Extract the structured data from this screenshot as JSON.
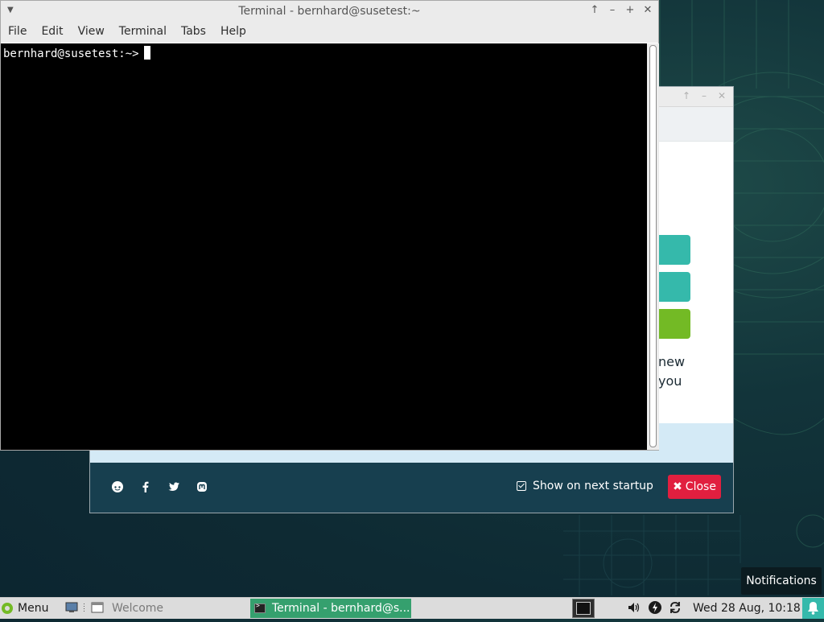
{
  "terminal": {
    "title": "Terminal - bernhard@susetest:~",
    "menu": [
      "File",
      "Edit",
      "View",
      "Terminal",
      "Tabs",
      "Help"
    ],
    "prompt": "bernhard@susetest:~>"
  },
  "welcome": {
    "partial_text_line1": "new",
    "partial_text_line2": "you",
    "show_on_startup_label": "Show on next startup",
    "show_on_startup_checked": true,
    "close_label": "Close",
    "social_icons": [
      "reddit-icon",
      "facebook-icon",
      "twitter-icon",
      "mastodon-icon"
    ],
    "colors": {
      "teal": "#35b9ab",
      "green": "#73ba25",
      "footer": "#173f4f",
      "close": "#e11f3f"
    }
  },
  "notifications_tooltip": "Notifications",
  "taskbar": {
    "menu_label": "Menu",
    "welcome_task": "Welcome",
    "terminal_task": "Terminal - bernhard@s...",
    "clock": "Wed 28 Aug, 10:18"
  }
}
